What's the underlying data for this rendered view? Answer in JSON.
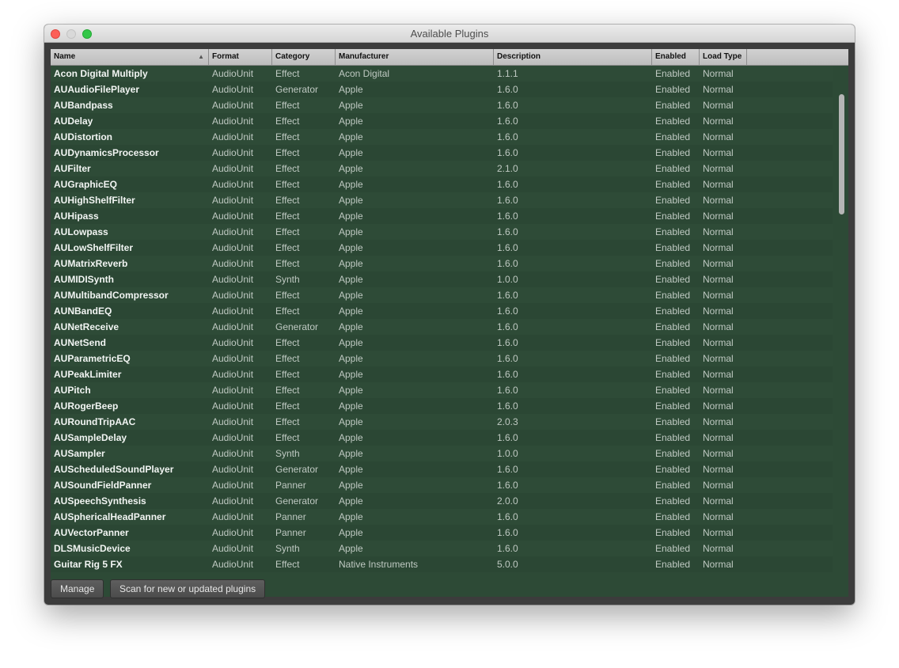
{
  "window": {
    "title": "Available Plugins"
  },
  "table": {
    "columns": [
      {
        "label": "Name",
        "sorted": "ascending"
      },
      {
        "label": "Format"
      },
      {
        "label": "Category"
      },
      {
        "label": "Manufacturer"
      },
      {
        "label": "Description"
      },
      {
        "label": "Enabled"
      },
      {
        "label": "Load Type"
      },
      {
        "label": ""
      }
    ],
    "rows": [
      [
        "Acon Digital Multiply",
        "AudioUnit",
        "Effect",
        "Acon Digital",
        "1.1.1",
        "Enabled",
        "Normal"
      ],
      [
        "AUAudioFilePlayer",
        "AudioUnit",
        "Generator",
        "Apple",
        "1.6.0",
        "Enabled",
        "Normal"
      ],
      [
        "AUBandpass",
        "AudioUnit",
        "Effect",
        "Apple",
        "1.6.0",
        "Enabled",
        "Normal"
      ],
      [
        "AUDelay",
        "AudioUnit",
        "Effect",
        "Apple",
        "1.6.0",
        "Enabled",
        "Normal"
      ],
      [
        "AUDistortion",
        "AudioUnit",
        "Effect",
        "Apple",
        "1.6.0",
        "Enabled",
        "Normal"
      ],
      [
        "AUDynamicsProcessor",
        "AudioUnit",
        "Effect",
        "Apple",
        "1.6.0",
        "Enabled",
        "Normal"
      ],
      [
        "AUFilter",
        "AudioUnit",
        "Effect",
        "Apple",
        "2.1.0",
        "Enabled",
        "Normal"
      ],
      [
        "AUGraphicEQ",
        "AudioUnit",
        "Effect",
        "Apple",
        "1.6.0",
        "Enabled",
        "Normal"
      ],
      [
        "AUHighShelfFilter",
        "AudioUnit",
        "Effect",
        "Apple",
        "1.6.0",
        "Enabled",
        "Normal"
      ],
      [
        "AUHipass",
        "AudioUnit",
        "Effect",
        "Apple",
        "1.6.0",
        "Enabled",
        "Normal"
      ],
      [
        "AULowpass",
        "AudioUnit",
        "Effect",
        "Apple",
        "1.6.0",
        "Enabled",
        "Normal"
      ],
      [
        "AULowShelfFilter",
        "AudioUnit",
        "Effect",
        "Apple",
        "1.6.0",
        "Enabled",
        "Normal"
      ],
      [
        "AUMatrixReverb",
        "AudioUnit",
        "Effect",
        "Apple",
        "1.6.0",
        "Enabled",
        "Normal"
      ],
      [
        "AUMIDISynth",
        "AudioUnit",
        "Synth",
        "Apple",
        "1.0.0",
        "Enabled",
        "Normal"
      ],
      [
        "AUMultibandCompressor",
        "AudioUnit",
        "Effect",
        "Apple",
        "1.6.0",
        "Enabled",
        "Normal"
      ],
      [
        "AUNBandEQ",
        "AudioUnit",
        "Effect",
        "Apple",
        "1.6.0",
        "Enabled",
        "Normal"
      ],
      [
        "AUNetReceive",
        "AudioUnit",
        "Generator",
        "Apple",
        "1.6.0",
        "Enabled",
        "Normal"
      ],
      [
        "AUNetSend",
        "AudioUnit",
        "Effect",
        "Apple",
        "1.6.0",
        "Enabled",
        "Normal"
      ],
      [
        "AUParametricEQ",
        "AudioUnit",
        "Effect",
        "Apple",
        "1.6.0",
        "Enabled",
        "Normal"
      ],
      [
        "AUPeakLimiter",
        "AudioUnit",
        "Effect",
        "Apple",
        "1.6.0",
        "Enabled",
        "Normal"
      ],
      [
        "AUPitch",
        "AudioUnit",
        "Effect",
        "Apple",
        "1.6.0",
        "Enabled",
        "Normal"
      ],
      [
        "AURogerBeep",
        "AudioUnit",
        "Effect",
        "Apple",
        "1.6.0",
        "Enabled",
        "Normal"
      ],
      [
        "AURoundTripAAC",
        "AudioUnit",
        "Effect",
        "Apple",
        "2.0.3",
        "Enabled",
        "Normal"
      ],
      [
        "AUSampleDelay",
        "AudioUnit",
        "Effect",
        "Apple",
        "1.6.0",
        "Enabled",
        "Normal"
      ],
      [
        "AUSampler",
        "AudioUnit",
        "Synth",
        "Apple",
        "1.0.0",
        "Enabled",
        "Normal"
      ],
      [
        "AUScheduledSoundPlayer",
        "AudioUnit",
        "Generator",
        "Apple",
        "1.6.0",
        "Enabled",
        "Normal"
      ],
      [
        "AUSoundFieldPanner",
        "AudioUnit",
        "Panner",
        "Apple",
        "1.6.0",
        "Enabled",
        "Normal"
      ],
      [
        "AUSpeechSynthesis",
        "AudioUnit",
        "Generator",
        "Apple",
        "2.0.0",
        "Enabled",
        "Normal"
      ],
      [
        "AUSphericalHeadPanner",
        "AudioUnit",
        "Panner",
        "Apple",
        "1.6.0",
        "Enabled",
        "Normal"
      ],
      [
        "AUVectorPanner",
        "AudioUnit",
        "Panner",
        "Apple",
        "1.6.0",
        "Enabled",
        "Normal"
      ],
      [
        "DLSMusicDevice",
        "AudioUnit",
        "Synth",
        "Apple",
        "1.6.0",
        "Enabled",
        "Normal"
      ],
      [
        "Guitar Rig 5 FX",
        "AudioUnit",
        "Effect",
        "Native Instruments",
        "5.0.0",
        "Enabled",
        "Normal"
      ]
    ]
  },
  "buttons": {
    "manage": "Manage",
    "scan": "Scan for new or updated plugins"
  },
  "colors": {
    "row_background": "#2e4b37",
    "window_background": "#3c3c3c",
    "close": "#fc5f57",
    "zoom": "#33c748"
  },
  "icons": {
    "sort": "sort-ascending-icon"
  }
}
